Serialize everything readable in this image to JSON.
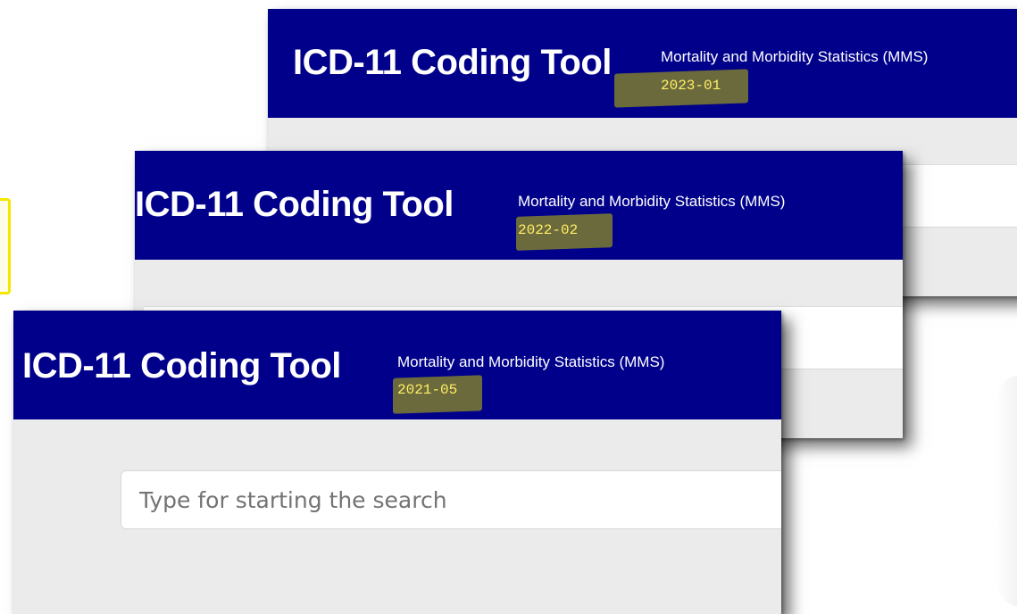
{
  "windows": [
    {
      "app_title": "ICD-11 Coding Tool",
      "subtitle": "Mortality and Morbidity Statistics (MMS)",
      "version": "2023-01"
    },
    {
      "app_title": "ICD-11 Coding Tool",
      "subtitle": "Mortality and Morbidity Statistics (MMS)",
      "version": "2022-02"
    },
    {
      "app_title": "ICD-11 Coding Tool",
      "subtitle": "Mortality and Morbidity Statistics (MMS)",
      "version": "2021-05",
      "search": {
        "placeholder": "Type for starting the search",
        "value": ""
      }
    }
  ],
  "colors": {
    "header_bg": "#00008b",
    "version_text": "#ffef66",
    "highlight": "#7e7d2e",
    "content_bg": "#ebebeb",
    "accent_yellow": "#f7e600"
  }
}
